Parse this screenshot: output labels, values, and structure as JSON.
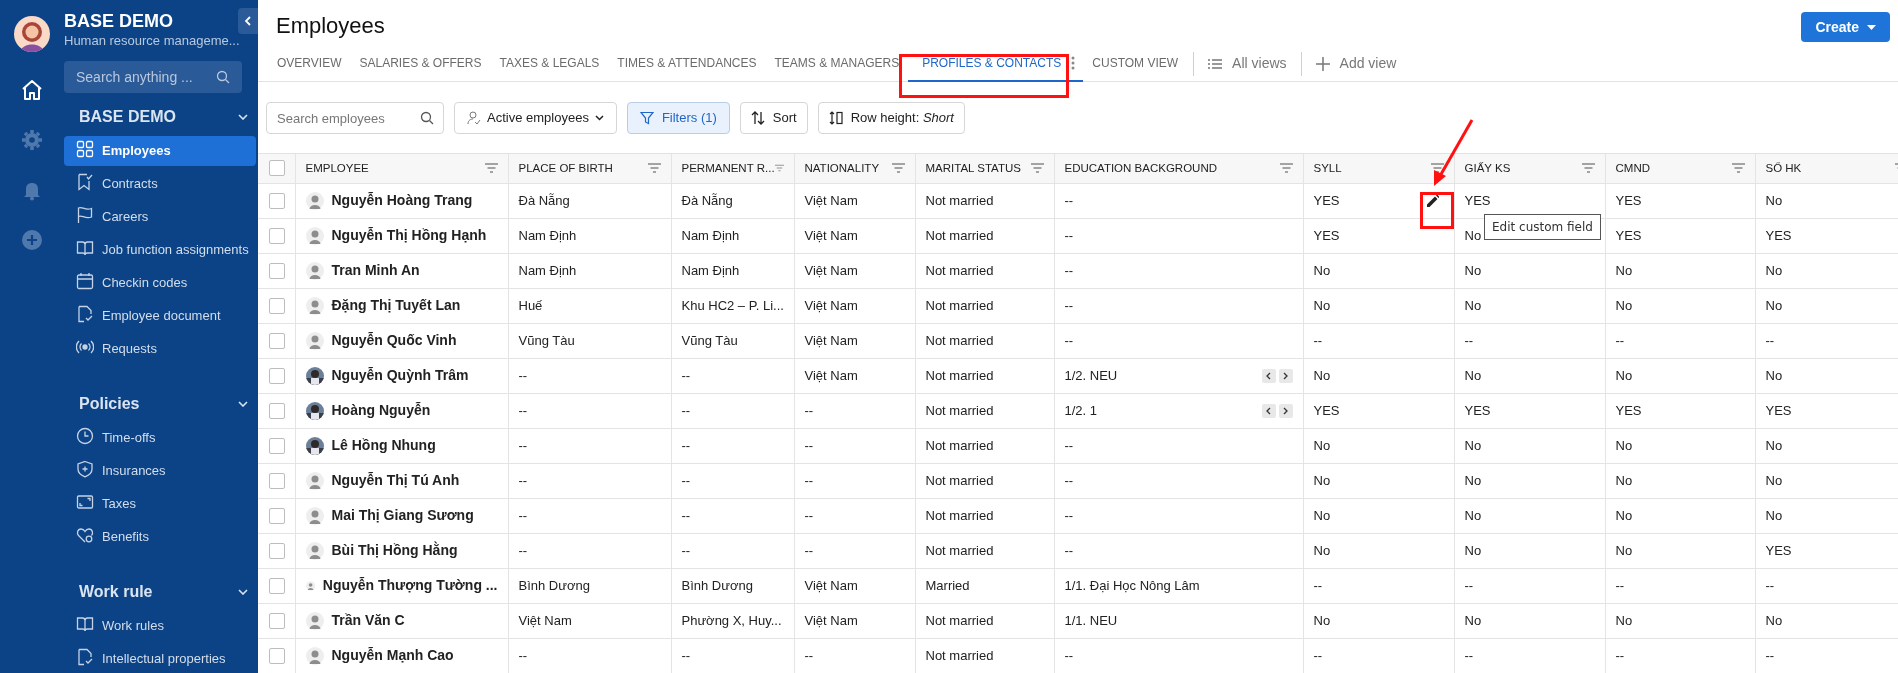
{
  "sidebar": {
    "title": "BASE DEMO",
    "subtitle": "Human resource manageme...",
    "search": {
      "placeholder": "Search anything ..."
    },
    "rail": [
      {
        "kind": "home",
        "selected": true
      },
      {
        "kind": "settings",
        "selected": false
      },
      {
        "kind": "bell",
        "selected": false
      },
      {
        "kind": "add",
        "selected": false
      }
    ],
    "groups": [
      {
        "title": "BASE DEMO",
        "expanded": true,
        "items": [
          {
            "label": "Employees",
            "selected": true
          },
          {
            "label": "Contracts",
            "selected": false
          },
          {
            "label": "Careers",
            "selected": false
          },
          {
            "label": "Job function assignments",
            "selected": false
          },
          {
            "label": "Checkin codes",
            "selected": false
          },
          {
            "label": "Employee document",
            "selected": false
          },
          {
            "label": "Requests",
            "selected": false
          }
        ]
      },
      {
        "title": "Policies",
        "expanded": true,
        "items": [
          {
            "label": "Time-offs",
            "selected": false
          },
          {
            "label": "Insurances",
            "selected": false
          },
          {
            "label": "Taxes",
            "selected": false
          },
          {
            "label": "Benefits",
            "selected": false
          }
        ]
      },
      {
        "title": "Work rule",
        "expanded": true,
        "items": [
          {
            "label": "Work rules",
            "selected": false
          },
          {
            "label": "Intellectual properties",
            "selected": false
          }
        ]
      }
    ]
  },
  "page": {
    "title": "Employees",
    "create_button": "Create"
  },
  "tabs": [
    {
      "label": "OVERVIEW",
      "selected": false
    },
    {
      "label": "SALARIES & OFFERS",
      "selected": false
    },
    {
      "label": "TAXES & LEGALS",
      "selected": false
    },
    {
      "label": "TIMES & ATTENDANCES",
      "selected": false
    },
    {
      "label": "TEAMS & MANAGERS",
      "selected": false
    },
    {
      "label": "PROFILES & CONTACTS",
      "selected": true
    },
    {
      "label": "CUSTOM VIEW",
      "selected": false
    }
  ],
  "view_actions": [
    "All views",
    "Add view"
  ],
  "toolbar": {
    "search": {
      "placeholder": "Search employees"
    },
    "status_filter": "Active employees",
    "filters": "Filters (1)",
    "sort": "Sort",
    "row_height": "Row height: *Short*"
  },
  "table": {
    "columns": [
      "EMPLOYEE",
      "PLACE OF BIRTH",
      "PERMANENT R...",
      "NATIONALITY",
      "MARITAL STATUS",
      "EDUCATION BACKGROUND",
      "SYLL",
      "GIẤY KS",
      "CMND",
      "SỔ HK"
    ],
    "header_checked": false,
    "rows": [
      {
        "checked": false,
        "kind": "default",
        "cells": [
          "Nguyễn Hoàng Trang",
          "Đà Nẵng",
          "Đà Nẵng",
          "Việt Nam",
          "Not married",
          "--",
          "YES",
          "YES",
          "YES",
          "No"
        ],
        "pager": false
      },
      {
        "checked": false,
        "kind": "default",
        "cells": [
          "Nguyễn Thị Hồng Hạnh",
          "Nam Định",
          "Nam Định",
          "Việt Nam",
          "Not married",
          "--",
          "YES",
          "No",
          "YES",
          "YES"
        ],
        "pager": false
      },
      {
        "checked": false,
        "kind": "default",
        "cells": [
          "Tran Minh An",
          "Nam Định",
          "Nam Định",
          "Việt Nam",
          "Not married",
          "--",
          "No",
          "No",
          "No",
          "No"
        ],
        "pager": false
      },
      {
        "checked": false,
        "kind": "default",
        "cells": [
          "Đặng Thị Tuyết Lan",
          "Huế",
          "Khu HC2 – P. Li...",
          "Việt Nam",
          "Not married",
          "--",
          "No",
          "No",
          "No",
          "No"
        ],
        "pager": false
      },
      {
        "checked": false,
        "kind": "default",
        "cells": [
          "Nguyễn Quốc Vinh",
          "Vũng Tàu",
          "Vũng Tàu",
          "Việt Nam",
          "Not married",
          "--",
          "--",
          "--",
          "--",
          "--"
        ],
        "pager": false
      },
      {
        "checked": false,
        "cells": [
          "Nguyễn Quỳnh Trâm",
          "--",
          "--",
          "Việt Nam",
          "Not married",
          "1/2. NEU",
          "No",
          "No",
          "No",
          "No"
        ],
        "pager": true
      },
      {
        "checked": false,
        "cells": [
          "Hoàng Nguyễn",
          "--",
          "--",
          "--",
          "Not married",
          "1/2. 1",
          "YES",
          "YES",
          "YES",
          "YES"
        ],
        "pager": true
      },
      {
        "checked": false,
        "cells": [
          "Lê Hồng Nhung",
          "--",
          "--",
          "--",
          "Not married",
          "--",
          "No",
          "No",
          "No",
          "No"
        ],
        "pager": false
      },
      {
        "checked": false,
        "kind": "default",
        "cells": [
          "Nguyễn Thị Tú Anh",
          "--",
          "--",
          "--",
          "Not married",
          "--",
          "No",
          "No",
          "No",
          "No"
        ],
        "pager": false
      },
      {
        "checked": false,
        "kind": "default",
        "cells": [
          "Mai Thị Giang Sương",
          "--",
          "--",
          "--",
          "Not married",
          "--",
          "No",
          "No",
          "No",
          "No"
        ],
        "pager": false
      },
      {
        "checked": false,
        "kind": "default",
        "cells": [
          "Bùi Thị Hồng Hằng",
          "--",
          "--",
          "--",
          "Not married",
          "--",
          "No",
          "No",
          "No",
          "YES"
        ],
        "pager": false
      },
      {
        "checked": false,
        "kind": "default",
        "cells": [
          "Nguyễn Thượng Tường ...",
          "Bình Dương",
          "Bình Dương",
          "Việt Nam",
          "Married",
          "1/1. Đại Học Nông Lâm",
          "--",
          "--",
          "--",
          "--"
        ],
        "pager": false
      },
      {
        "checked": false,
        "kind": "default",
        "cells": [
          "Trần Văn C",
          "Việt Nam",
          "Phường X, Huy...",
          "Việt Nam",
          "Not married",
          "1/1. NEU",
          "No",
          "No",
          "No",
          "No"
        ],
        "pager": false
      },
      {
        "checked": false,
        "kind": "default",
        "cells": [
          "Nguyễn Mạnh Cao",
          "--",
          "--",
          "--",
          "Not married",
          "--",
          "--",
          "--",
          "--",
          "--"
        ],
        "pager": false
      }
    ]
  },
  "tooltip": "Edit custom field"
}
